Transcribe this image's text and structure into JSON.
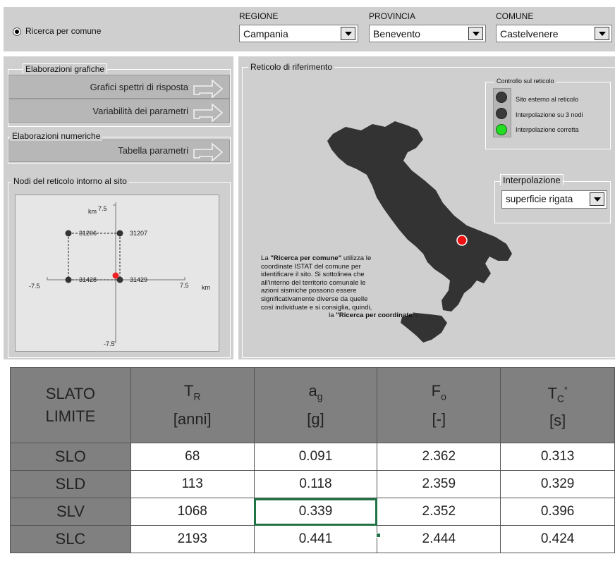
{
  "header": {
    "search_mode_label": "Ricerca per comune",
    "regione": {
      "label": "REGIONE",
      "value": "Campania"
    },
    "provincia": {
      "label": "PROVINCIA",
      "value": "Benevento"
    },
    "comune": {
      "label": "COMUNE",
      "value": "Castelvenere"
    }
  },
  "left_panel": {
    "graphic_group_title": "Elaborazioni grafiche",
    "btn_spectra": "Grafici spettri di risposta",
    "btn_variability": "Variabilità dei parametri",
    "numeric_group_title": "Elaborazioni numeriche",
    "btn_table": "Tabella parametri",
    "nodes_group_title": "Nodi del reticolo intorno al sito"
  },
  "node_plot": {
    "y_top_label": "7.5",
    "y_bottom_label": "-7.5",
    "x_left_label": "-7.5",
    "x_right_label": "7.5",
    "unit_y": "km",
    "unit_x": "km",
    "nodes": [
      "31206",
      "31207",
      "31428",
      "31429"
    ]
  },
  "right_panel": {
    "title": "Reticolo di riferimento",
    "control_title": "Controllo sul reticolo",
    "status_items": [
      {
        "label": "Sito esterno al reticolo",
        "color": "#3a3a3a"
      },
      {
        "label": "Interpolazione su 3 nodi",
        "color": "#3a3a3a"
      },
      {
        "label": "Interpolazione corretta",
        "color": "#22dd22"
      }
    ],
    "interp_title": "Interpolazione",
    "interp_value": "superficie rigata",
    "note_lines": [
      [
        "La ",
        "\"Ricerca per comune\"",
        " utilizza le"
      ],
      [
        "coordinate ISTAT del comune per"
      ],
      [
        "identificare il sito. Si sottolinea che"
      ],
      [
        "all'interno del territorio comunale le"
      ],
      [
        "azioni sismiche possono essere"
      ],
      [
        "significativamente diverse da quelle"
      ],
      [
        "così individuate e si consiglia, quindi,"
      ],
      [
        "la ",
        "\"Ricerca per coordinate\"",
        "."
      ]
    ]
  },
  "table": {
    "headers": [
      {
        "line1": "SLATO",
        "line2": "LIMITE"
      },
      {
        "main": "T",
        "sub": "R",
        "unit": "[anni]"
      },
      {
        "main": "a",
        "sub": "g",
        "unit": "[g]"
      },
      {
        "main": "F",
        "sub": "o",
        "unit": "[-]"
      },
      {
        "main": "T",
        "sub": "C",
        "sup": "*",
        "unit": "[s]"
      }
    ],
    "rows": [
      [
        "SLO",
        "68",
        "0.091",
        "2.362",
        "0.313"
      ],
      [
        "SLD",
        "113",
        "0.118",
        "2.359",
        "0.329"
      ],
      [
        "SLV",
        "1068",
        "0.339",
        "2.352",
        "0.396"
      ],
      [
        "SLC",
        "2193",
        "0.441",
        "2.444",
        "0.424"
      ]
    ]
  }
}
